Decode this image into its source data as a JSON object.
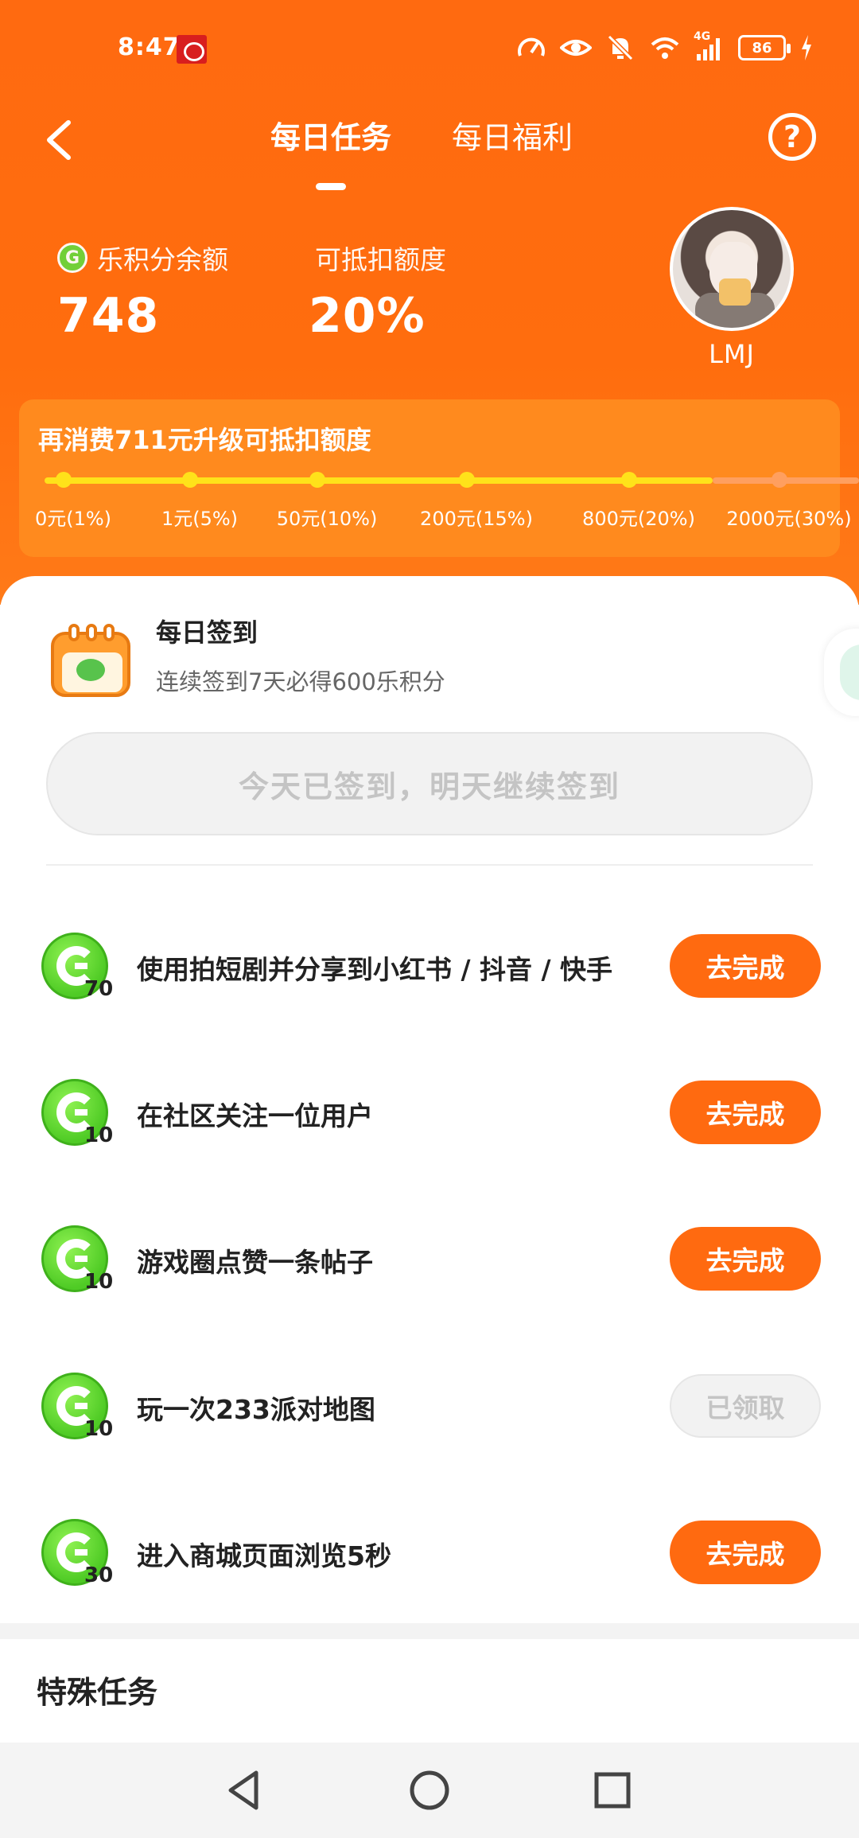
{
  "status_bar": {
    "time": "8:47",
    "network": "4G",
    "battery": "86"
  },
  "nav": {
    "tabs": [
      {
        "label": "每日任务",
        "active": true
      },
      {
        "label": "每日福利",
        "active": false
      }
    ],
    "help_symbol": "?"
  },
  "points": {
    "balance_label": "乐积分余额",
    "balance_value": "748",
    "deduct_label": "可抵扣额度",
    "deduct_value": "20%",
    "username": "LMJ"
  },
  "upgrade": {
    "title": "再消费711元升级可抵扣额度",
    "progress_fraction": 0.82,
    "ticks": [
      "0元(1%)",
      "1元(5%)",
      "50元(10%)",
      "200元(15%)",
      "800元(20%)",
      "2000元(30%)"
    ]
  },
  "checkin": {
    "title": "每日签到",
    "subtitle": "连续签到7天必得600乐积分",
    "button": "今天已签到，明天继续签到"
  },
  "tasks": [
    {
      "points": "70",
      "label": "使用拍短剧并分享到小红书 / 抖音 / 快手",
      "button": "去完成",
      "done": false
    },
    {
      "points": "10",
      "label": "在社区关注一位用户",
      "button": "去完成",
      "done": false
    },
    {
      "points": "10",
      "label": "游戏圈点赞一条帖子",
      "button": "去完成",
      "done": false
    },
    {
      "points": "10",
      "label": "玩一次233派对地图",
      "button": "已领取",
      "done": true
    },
    {
      "points": "30",
      "label": "进入商城页面浏览5秒",
      "button": "去完成",
      "done": false
    }
  ],
  "special": {
    "title": "特殊任务"
  },
  "colors": {
    "brand_orange": "#ff6a10",
    "progress_yellow": "#ffe21a",
    "coin_green": "#4fcb25"
  }
}
